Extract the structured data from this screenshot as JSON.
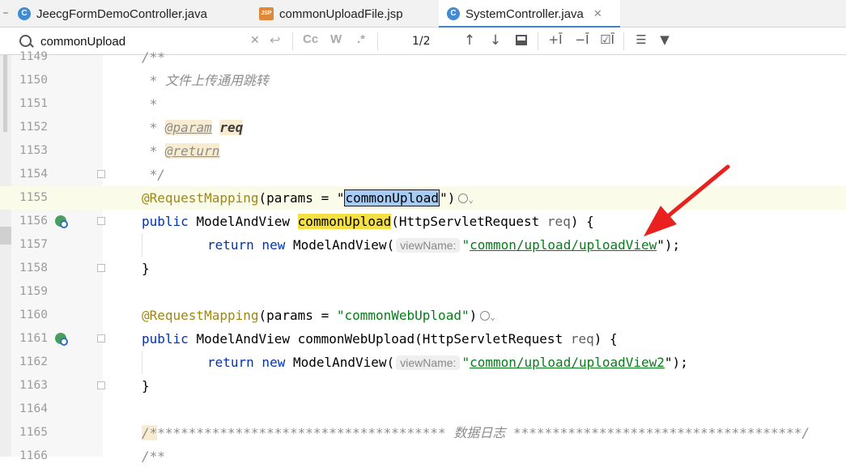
{
  "tabs": [
    {
      "label": "JeecgFormDemoController.java",
      "icon": "java-class-icon"
    },
    {
      "label": "commonUploadFile.jsp",
      "icon": "jsp-file-icon"
    },
    {
      "label": "SystemController.java",
      "icon": "java-class-icon",
      "active": true
    }
  ],
  "tab_icon_c": "C",
  "tab_icon_jsp": "JSP",
  "search": {
    "value": "commonUpload",
    "match_count": "1/2",
    "opt_case": "Cc",
    "opt_word": "W",
    "opt_regex": ".*"
  },
  "lines": [
    {
      "num": "1149"
    },
    {
      "num": "1150"
    },
    {
      "num": "1151"
    },
    {
      "num": "1152"
    },
    {
      "num": "1153"
    },
    {
      "num": "1154"
    },
    {
      "num": "1155"
    },
    {
      "num": "1156"
    },
    {
      "num": "1157"
    },
    {
      "num": "1158"
    },
    {
      "num": "1159"
    },
    {
      "num": "1160"
    },
    {
      "num": "1161"
    },
    {
      "num": "1162"
    },
    {
      "num": "1163"
    },
    {
      "num": "1164"
    },
    {
      "num": "1165"
    },
    {
      "num": "1166"
    }
  ],
  "code": {
    "l1149": "/**",
    "l1150": " * 文件上传通用跳转",
    "l1151": " *",
    "l1152_star": " * ",
    "l1152_tag": "@param",
    "l1152_val": "req",
    "l1153_star": " * ",
    "l1153_tag": "@return",
    "l1154": " */",
    "l1155_anno": "@RequestMapping",
    "l1155_open": "(params = \"",
    "l1155_sel": "commonUpload",
    "l1155_close": "\")",
    "l1156_kw": "public ",
    "l1156_type": "ModelAndView ",
    "l1156_name": "commonUpload",
    "l1156_sig": "(HttpServletRequest ",
    "l1156_param": "req",
    "l1156_end": ") {",
    "l1157_kw": "return new ",
    "l1157_type": "ModelAndView(",
    "l1157_hint": "viewName:",
    "l1157_q": "\"",
    "l1157_str": "common/upload/uploadView",
    "l1157_end": "\");",
    "l1158": "}",
    "l1160_anno": "@RequestMapping",
    "l1160_rest": "(params = ",
    "l1160_str": "\"commonWebUpload\"",
    "l1160_close": ")",
    "l1161_kw": "public ",
    "l1161_type": "ModelAndView ",
    "l1161_name": "commonWebUpload",
    "l1161_sig": "(HttpServletRequest ",
    "l1161_param": "req",
    "l1161_end": ") {",
    "l1162_kw": "return new ",
    "l1162_type": "ModelAndView(",
    "l1162_hint": "viewName:",
    "l1162_q": "\"",
    "l1162_str": "common/upload/uploadView2",
    "l1162_end": "\");",
    "l1163": "}",
    "l1165_start": "/*",
    "l1165_rest": "************************************* 数据日志 *************************************/",
    "l1166": "/**"
  },
  "colors": {
    "keyword": "#0033b3",
    "annotation": "#9e880d",
    "string": "#067d17",
    "comment": "#8c8c8c",
    "search_highlight": "#f5e042",
    "selection": "#a6cbf5",
    "arrow": "#e8201e"
  }
}
